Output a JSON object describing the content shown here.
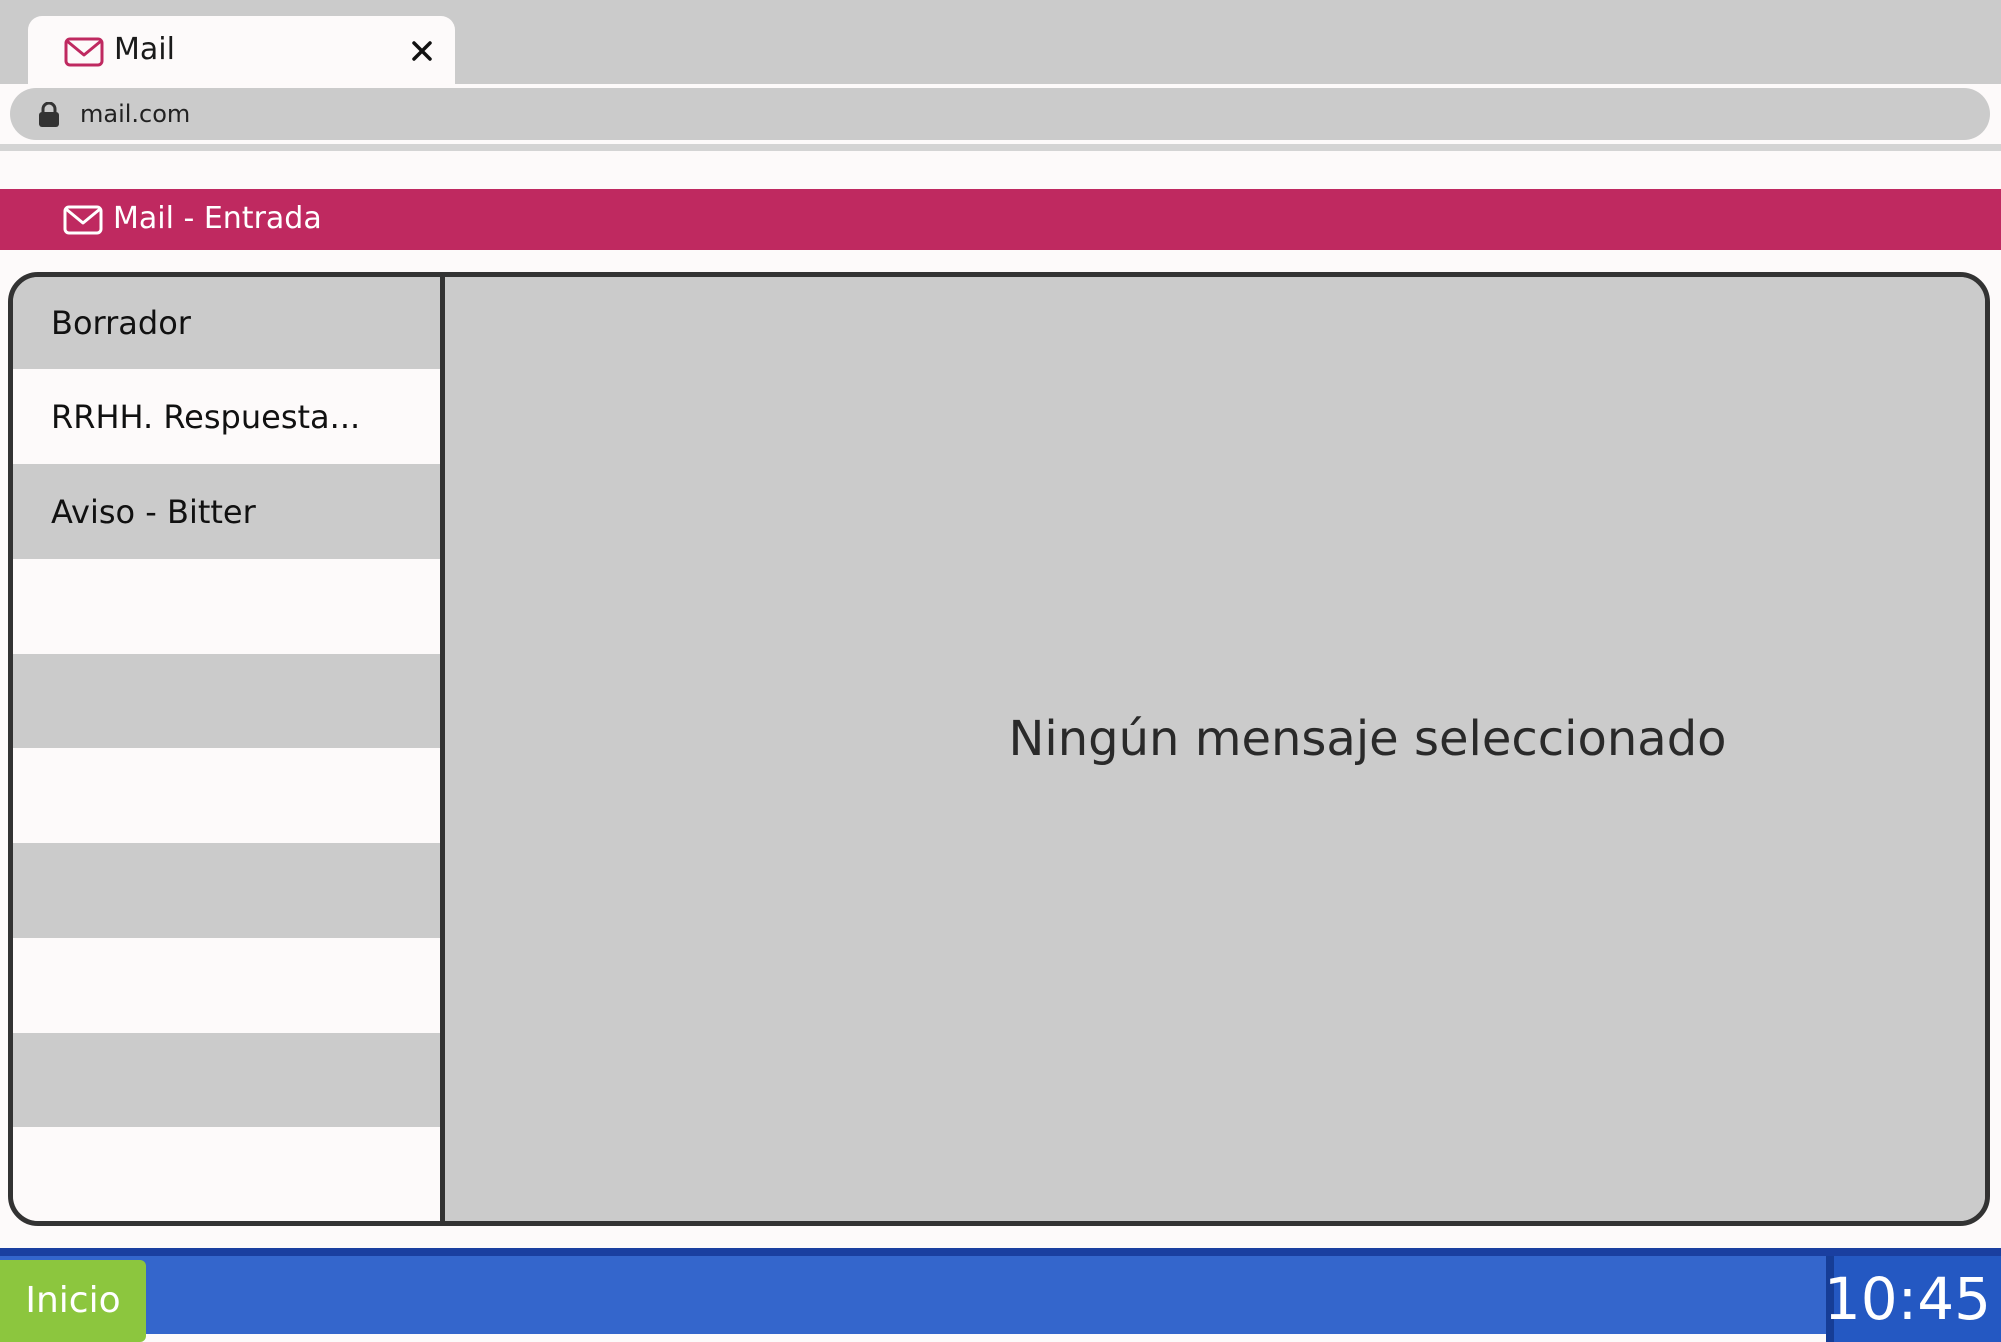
{
  "browser": {
    "tab_title": "Mail",
    "tab_icon": "mail-icon",
    "close_icon": "close-icon",
    "url": "mail.com",
    "lock_icon": "lock-icon"
  },
  "app": {
    "title": "Mail - Entrada",
    "icon": "mail-icon",
    "accent_color": "#bf2960"
  },
  "messages": [
    {
      "subject": "Borrador"
    },
    {
      "subject": "RRHH. Respuesta..."
    },
    {
      "subject": "Aviso - Bitter"
    },
    {
      "subject": ""
    },
    {
      "subject": ""
    },
    {
      "subject": ""
    },
    {
      "subject": ""
    },
    {
      "subject": ""
    },
    {
      "subject": ""
    },
    {
      "subject": ""
    }
  ],
  "preview": {
    "empty_message": "Ningún mensaje seleccionado"
  },
  "taskbar": {
    "start_label": "Inicio",
    "clock": "10:45",
    "start_color": "#8cc63e",
    "bar_color": "#3466cc"
  }
}
